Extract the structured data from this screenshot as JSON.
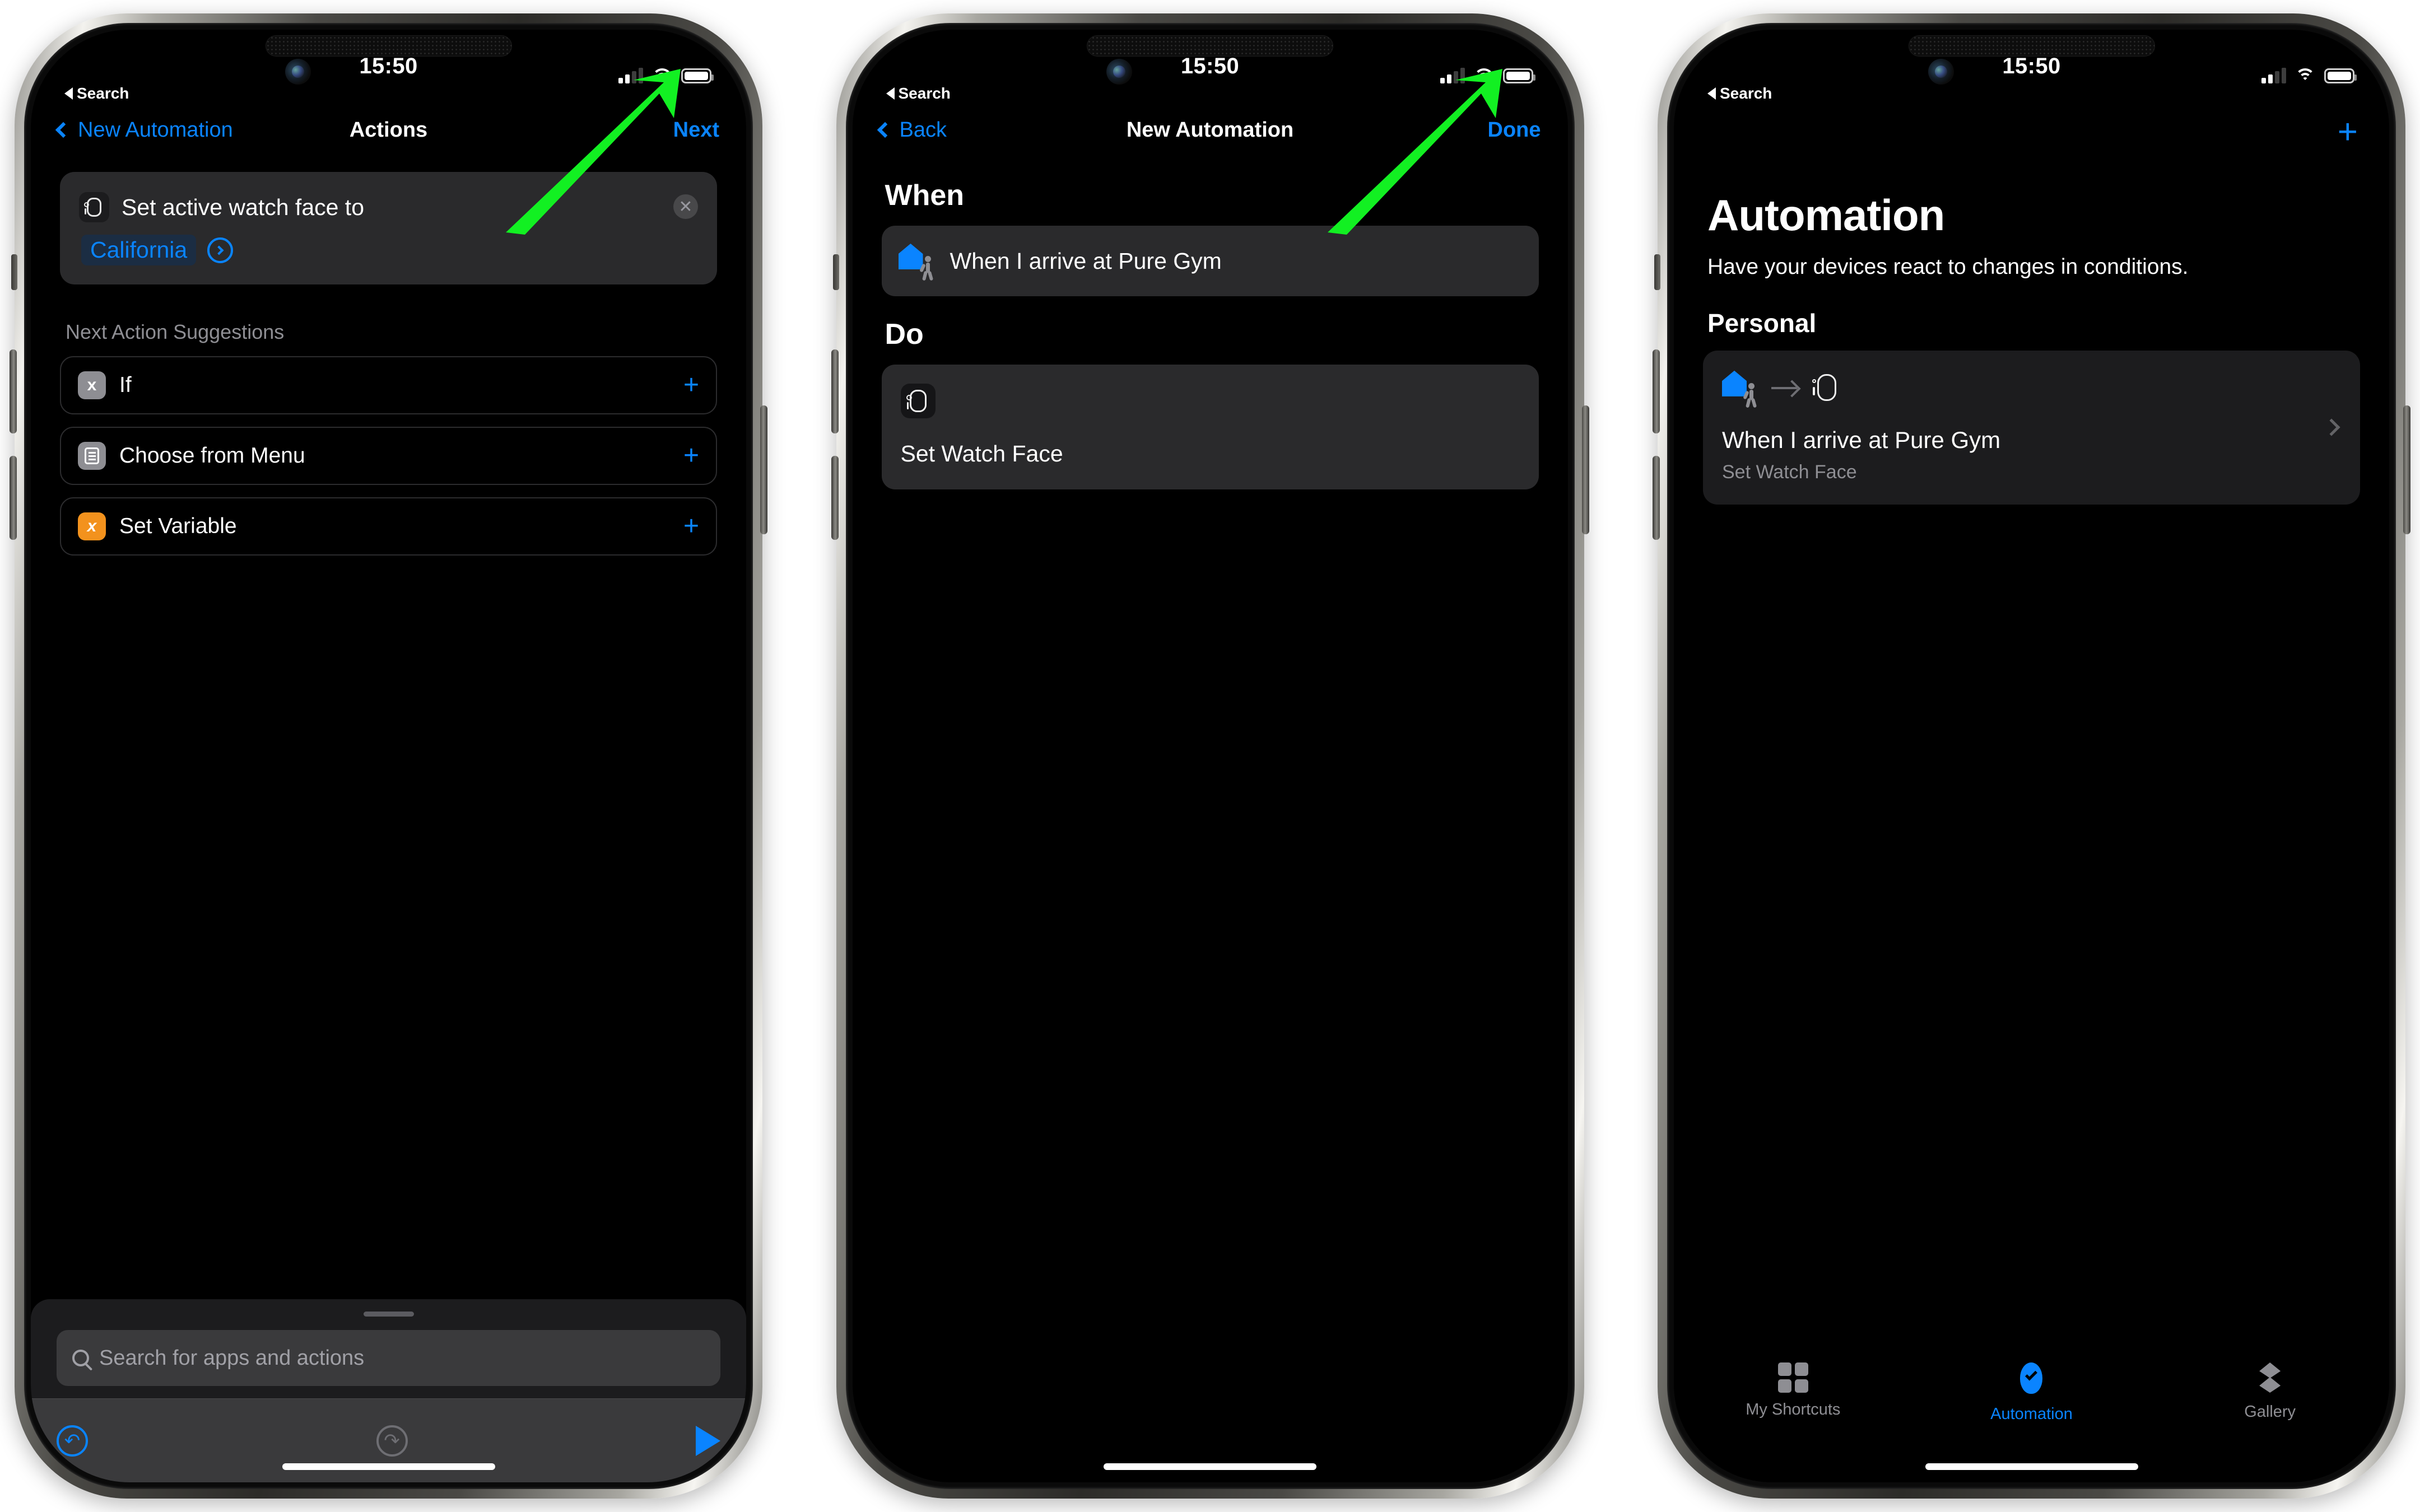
{
  "status_bar": {
    "time": "15:50",
    "back_app": "Search",
    "icons": [
      "cellular-bars-icon",
      "wifi-icon",
      "battery-icon"
    ]
  },
  "accent_colors": {
    "blue": "#0a84ff",
    "annotation_green": "#12f022",
    "orange": "#f3921d",
    "grey": "#8e8e93"
  },
  "phone1": {
    "nav": {
      "back_label": "New Automation",
      "title": "Actions",
      "action_label": "Next"
    },
    "action_card": {
      "icon": "apple-watch-icon",
      "text": "Set active watch face to",
      "parameter": "California",
      "parameter_chevron": "chevron-right-circle-icon",
      "remove": "close-circle-icon"
    },
    "suggestions_header": "Next Action Suggestions",
    "suggestions": [
      {
        "label": "If",
        "icon": "branch-icon",
        "icon_color": "grey",
        "add": "plus-icon"
      },
      {
        "label": "Choose from Menu",
        "icon": "menu-list-icon",
        "icon_color": "grey",
        "add": "plus-icon"
      },
      {
        "label": "Set Variable",
        "icon": "variable-x-icon",
        "icon_color": "orange",
        "add": "plus-icon"
      }
    ],
    "search": {
      "placeholder": "Search for apps and actions",
      "icon": "search-icon"
    },
    "toolbar": {
      "undo": "undo-icon",
      "redo": "redo-icon",
      "run": "play-icon"
    }
  },
  "phone2": {
    "nav": {
      "back_label": "Back",
      "title": "New Automation",
      "action_label": "Done"
    },
    "when": {
      "header": "When",
      "trigger": "When I arrive at Pure Gym",
      "icon": "home-arrive-icon"
    },
    "do": {
      "header": "Do",
      "action": "Set Watch Face",
      "icon": "apple-watch-icon"
    }
  },
  "phone3": {
    "add_button": "plus-icon",
    "title": "Automation",
    "subtitle": "Have your devices react to changes in conditions.",
    "group_label": "Personal",
    "automation": {
      "trigger_icon": "home-arrive-icon",
      "arrow_icon": "arrow-right-icon",
      "action_icon": "apple-watch-icon",
      "name": "When I arrive at Pure Gym",
      "detail": "Set Watch Face",
      "disclosure": "chevron-right-icon"
    },
    "tabs": [
      {
        "label": "My Shortcuts",
        "icon": "grid-icon",
        "active": false
      },
      {
        "label": "Automation",
        "icon": "automation-check-icon",
        "active": true
      },
      {
        "label": "Gallery",
        "icon": "gallery-layers-icon",
        "active": false
      }
    ]
  }
}
